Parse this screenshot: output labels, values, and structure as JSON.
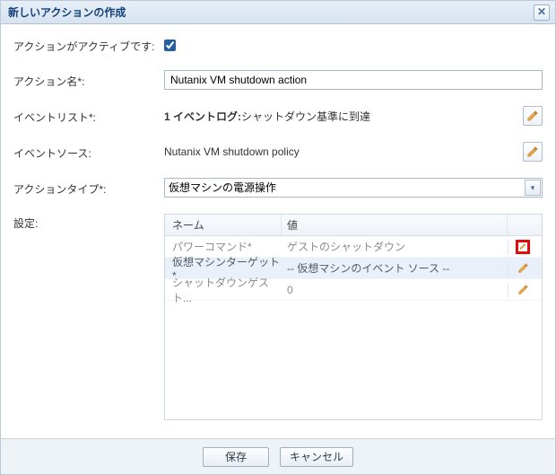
{
  "dialog": {
    "title": "新しいアクションの作成"
  },
  "fields": {
    "active_label": "アクションがアクティブです:",
    "active_checked": true,
    "name_label": "アクション名*:",
    "name_value": "Nutanix VM shutdown action",
    "eventlist_label": "イベントリスト*:",
    "eventlist_value_prefix": "1 イベントログ:",
    "eventlist_value_rest": " シャットダウン基準に到達",
    "eventsource_label": "イベントソース:",
    "eventsource_value": "Nutanix VM shutdown policy",
    "actiontype_label": "アクションタイプ*:",
    "actiontype_value": "仮想マシンの電源操作",
    "settings_label": "設定:"
  },
  "grid": {
    "header_name": "ネーム",
    "header_value": "値",
    "rows": [
      {
        "name": "パワーコマンド*",
        "value": "ゲストのシャットダウン",
        "highlighted": true
      },
      {
        "name": "仮想マシンターゲット*",
        "value": "-- 仮想マシンのイベント ソース --",
        "selected": true
      },
      {
        "name": "シャットダウンゲスト...",
        "value": "0"
      }
    ]
  },
  "footer": {
    "save": "保存",
    "cancel": "キャンセル"
  }
}
